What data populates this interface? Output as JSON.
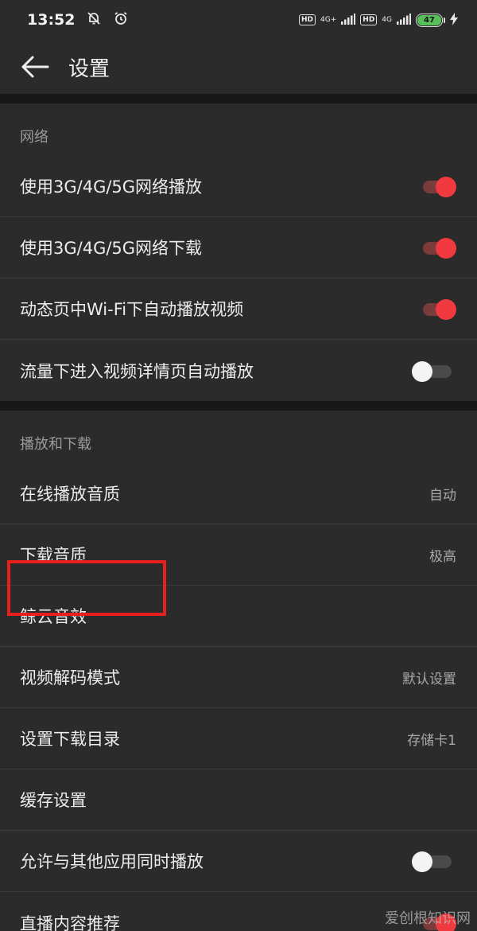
{
  "status_bar": {
    "time": "13:52",
    "hd1": "HD",
    "net1": "4G+",
    "hd2": "HD",
    "net2": "4G",
    "battery": "47"
  },
  "header": {
    "title": "设置"
  },
  "sections": [
    {
      "title": "网络",
      "items": [
        {
          "label": "使用3G/4G/5G网络播放",
          "toggle": "on"
        },
        {
          "label": "使用3G/4G/5G网络下载",
          "toggle": "on"
        },
        {
          "label": "动态页中Wi-Fi下自动播放视频",
          "toggle": "on"
        },
        {
          "label": "流量下进入视频详情页自动播放",
          "toggle": "off"
        }
      ]
    },
    {
      "title": "播放和下载",
      "items": [
        {
          "label": "在线播放音质",
          "value": "自动"
        },
        {
          "label": "下载音质",
          "value": "极高"
        },
        {
          "label": "鲸云音效"
        },
        {
          "label": "视频解码模式",
          "value": "默认设置"
        },
        {
          "label": "设置下载目录",
          "value": "存储卡1"
        },
        {
          "label": "缓存设置"
        },
        {
          "label": "允许与其他应用同时播放",
          "toggle": "off"
        },
        {
          "label": "直播内容推荐",
          "toggle": "on"
        }
      ]
    }
  ],
  "colors": {
    "accent": "#f03a3f",
    "highlight": "#e8201d",
    "background": "#2b2b2b"
  },
  "watermark": "爱创根知识网"
}
